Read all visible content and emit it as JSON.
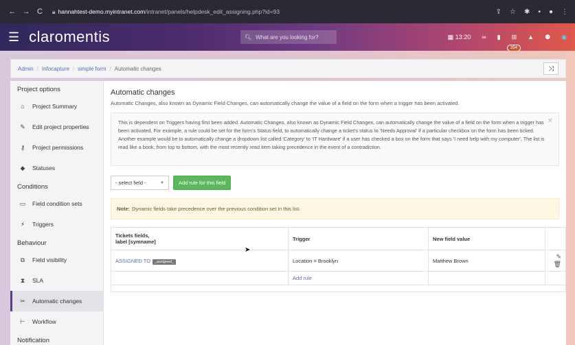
{
  "browser": {
    "url_host": "hannahtest-demo.myintranet.com",
    "url_path": "/intranet/panels/helpdesk_edit_assigning.php?id=93"
  },
  "header": {
    "logo": "claromentis",
    "search_placeholder": "What are you looking for?",
    "time": "13:20",
    "notification_count": "354"
  },
  "breadcrumb": {
    "items": [
      "Admin",
      "Infocapture",
      "simple form"
    ],
    "current": "Automatic changes"
  },
  "sidebar": {
    "section_project": "Project options",
    "project_summary": "Project Summary",
    "edit_project_properties": "Edit project properties",
    "project_permissions": "Project permissions",
    "statuses": "Statuses",
    "section_conditions": "Conditions",
    "field_condition_sets": "Field condition sets",
    "triggers": "Triggers",
    "section_behaviour": "Behaviour",
    "field_visibility": "Field visibility",
    "sla": "SLA",
    "automatic_changes": "Automatic changes",
    "workflow": "Workflow",
    "section_notification": "Notification"
  },
  "main": {
    "title": "Automatic changes",
    "description": "Automatic Changes, also known as Dynamic Field Changes, can automatically change the value of a field on the form when a trigger has been activated.",
    "info": "This is dependent on Triggers having first been added. Automatic Changes, also known as Dynamic Field Changes, can automatically change the value of a field on the form when a trigger has been activated. For example, a rule could be set for the form's Status field, to automatically change a ticket's status to 'Needs Approval' if a particular checkbox on the form has been ticked. Another example would be to automatically change a dropdown list called 'Category' to 'IT Hardware' if a user has checked a box on the form that says 'I need help with my computer'. The list is read like a book, from top to bottom, with the most recently read item taking precedence in the event of a contradiction.",
    "select_value": "- select field -",
    "add_rule_button": "Add rule for this field",
    "note_label": "Note:",
    "note_text": "Dynamic fields take precedence over the previous condition set in this list."
  },
  "table": {
    "col1_line1": "Tickets fields,",
    "col1_line2": "label [symname]",
    "col2": "Trigger",
    "col3": "New field value",
    "row_field": "ASSIGNED TO",
    "row_tag": "_assigned_",
    "row_trigger": "Location = Brooklyn",
    "row_value": "Matthew Brown",
    "add_rule_link": "Add rule"
  }
}
